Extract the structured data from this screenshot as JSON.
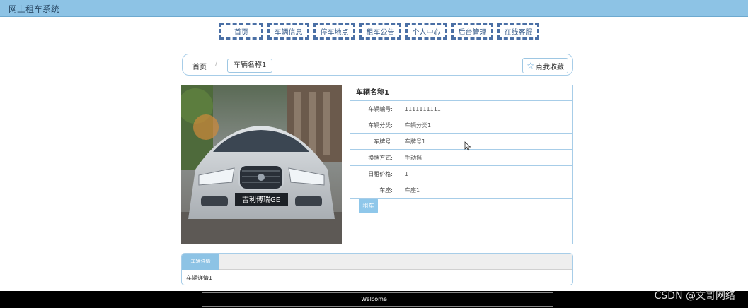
{
  "app": {
    "title": "网上租车系统"
  },
  "nav": {
    "items": [
      {
        "label": "首页"
      },
      {
        "label": "车辆信息"
      },
      {
        "label": "停车地点"
      },
      {
        "label": "租车公告"
      },
      {
        "label": "个人中心"
      },
      {
        "label": "后台管理"
      },
      {
        "label": "在线客服"
      }
    ]
  },
  "breadcrumb": {
    "home": "首页",
    "separator": "/",
    "current": "车辆名称1",
    "favorite_label": "点我收藏"
  },
  "car": {
    "photo_badge": "吉利博瑞GE",
    "name": "车辆名称1",
    "rows": [
      {
        "label": "车辆编号:",
        "value": "1111111111"
      },
      {
        "label": "车辆分类:",
        "value": "车辆分类1"
      },
      {
        "label": "车牌号:",
        "value": "车牌号1"
      },
      {
        "label": "换挡方式:",
        "value": "手动挡"
      },
      {
        "label": "日租价格:",
        "value": "1"
      },
      {
        "label": "车座:",
        "value": "车座1"
      }
    ],
    "rent_label": "租车"
  },
  "detail": {
    "tab_label": "车辆详情",
    "content": "车辆详情1"
  },
  "footer": {
    "welcome": "Welcome"
  },
  "watermark": "CSDN @文哥网络",
  "colors": {
    "topbar": "#8dc3e5",
    "nav_border": "#4a6fa5",
    "border": "#a7cde8",
    "button": "#8fc7ea"
  }
}
